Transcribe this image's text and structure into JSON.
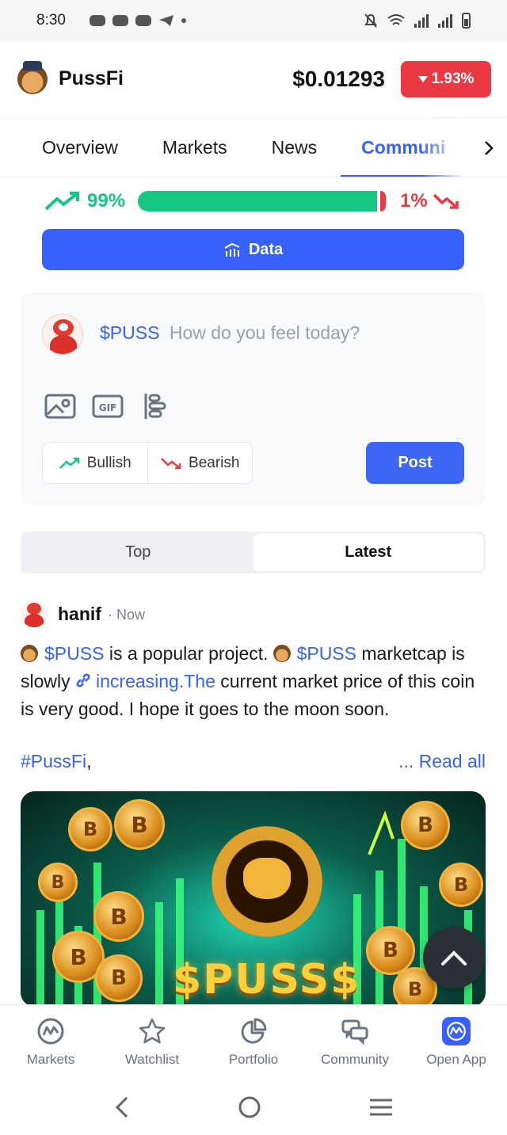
{
  "status_bar": {
    "time": "8:30"
  },
  "coin": {
    "name": "PussFi",
    "price": "$0.01293",
    "change": "1.93%",
    "change_color": "#ea3943"
  },
  "tabs": [
    "Overview",
    "Markets",
    "News",
    "Communi"
  ],
  "active_tab": 3,
  "sentiment": {
    "bullish_percent": "99%",
    "bearish_percent": "1%",
    "bullish_fraction": 0.99,
    "bullish_color": "#16c784",
    "bearish_color": "#ea3943"
  },
  "data_button": "Data",
  "composer": {
    "tag": "$PUSS",
    "placeholder": "How do you feel today?",
    "bullish_label": "Bullish",
    "bearish_label": "Bearish",
    "post_label": "Post"
  },
  "sort": [
    "Top",
    "Latest"
  ],
  "active_sort": 1,
  "post": {
    "author": "hanif",
    "time": "· Now",
    "tag1": "$PUSS",
    "text1": " is a popular project.",
    "tag2": "$PUSS",
    "text2": " marketcap is slowly ",
    "link": "increasing.The",
    "text3": " current market price of this coin is very good. I hope it goes to the moon soon.",
    "hashtag": "#PussFi",
    "hashtag_suffix": ",",
    "read_all": "... Read all",
    "image_text": "$PUSS$",
    "image_coin_symbol": "B"
  },
  "bottom_nav": [
    {
      "label": "Markets",
      "icon": "markets-icon"
    },
    {
      "label": "Watchlist",
      "icon": "star-icon"
    },
    {
      "label": "Portfolio",
      "icon": "pie-chart-icon"
    },
    {
      "label": "Community",
      "icon": "chat-bubbles-icon"
    },
    {
      "label": "Open App",
      "icon": "open-app-icon"
    }
  ],
  "colors": {
    "accent": "#3861fb"
  }
}
